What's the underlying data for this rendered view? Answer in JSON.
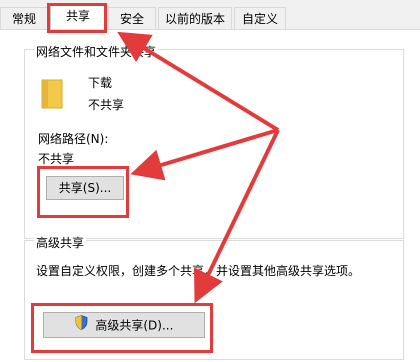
{
  "tabs": [
    {
      "label": "常规"
    },
    {
      "label": "共享"
    },
    {
      "label": "安全"
    },
    {
      "label": "以前的版本"
    },
    {
      "label": "自定义"
    }
  ],
  "network_sharing": {
    "title": "网络文件和文件夹共享",
    "folder_name": "下载",
    "share_status": "不共享",
    "path_label": "网络路径(N):",
    "path_value": "不共享",
    "share_button": "共享(S)..."
  },
  "advanced_sharing": {
    "title": "高级共享",
    "description": "设置自定义权限，创建多个共享，并设置其他高级共享选项。",
    "button": "高级共享(D)..."
  },
  "colors": {
    "highlight": "#e23b3b",
    "folder": "#f3c94a"
  }
}
